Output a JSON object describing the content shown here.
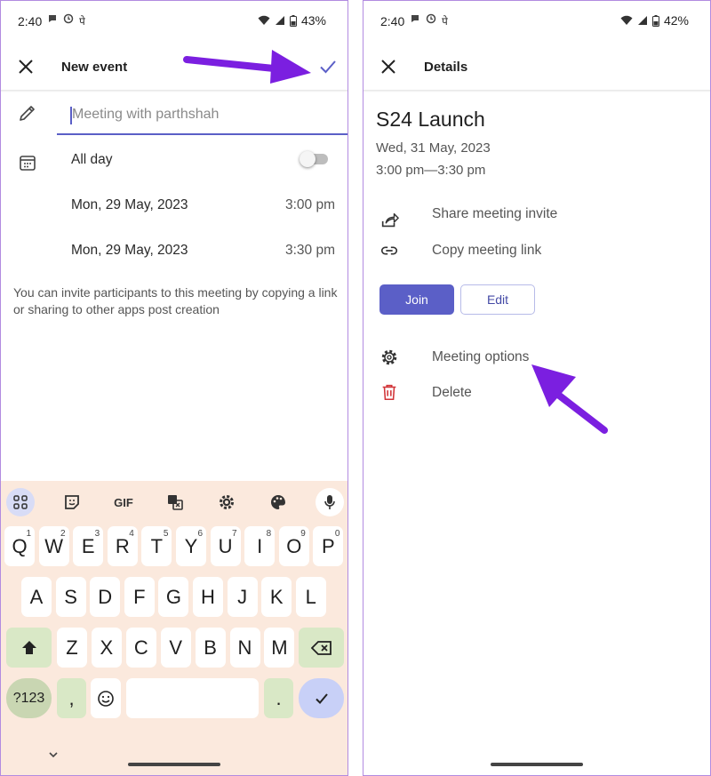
{
  "status_left": {
    "time": "2:40",
    "battery": "43%"
  },
  "status_right": {
    "time": "2:40",
    "battery": "42%"
  },
  "status_icons": {
    "hindi": "पे"
  },
  "new_event": {
    "title": "New event",
    "title_placeholder": "Meeting with parthshah",
    "all_day_label": "All day",
    "all_day_on": false,
    "start_date": "Mon, 29 May, 2023",
    "start_time": "3:00 pm",
    "end_date": "Mon, 29 May, 2023",
    "end_time": "3:30 pm",
    "invite_note": "You can invite participants to this meeting by copying a link or sharing to other apps post creation"
  },
  "keyboard": {
    "gif_label": "GIF",
    "row1": [
      {
        "k": "Q",
        "n": "1"
      },
      {
        "k": "W",
        "n": "2"
      },
      {
        "k": "E",
        "n": "3"
      },
      {
        "k": "R",
        "n": "4"
      },
      {
        "k": "T",
        "n": "5"
      },
      {
        "k": "Y",
        "n": "6"
      },
      {
        "k": "U",
        "n": "7"
      },
      {
        "k": "I",
        "n": "8"
      },
      {
        "k": "O",
        "n": "9"
      },
      {
        "k": "P",
        "n": "0"
      }
    ],
    "row2": [
      "A",
      "S",
      "D",
      "F",
      "G",
      "H",
      "J",
      "K",
      "L"
    ],
    "row3": [
      "Z",
      "X",
      "C",
      "V",
      "B",
      "N",
      "M"
    ],
    "symbols_label": "?123",
    "comma": ",",
    "period": "."
  },
  "details": {
    "title": "Details",
    "event_name": "S24 Launch",
    "date": "Wed, 31 May, 2023",
    "time": "3:00 pm—3:30 pm",
    "share": "Share meeting invite",
    "copy": "Copy meeting link",
    "join": "Join",
    "edit": "Edit",
    "options": "Meeting options",
    "delete": "Delete"
  },
  "colors": {
    "accent": "#5b5fc7",
    "annotation_arrow": "#7b1fe0",
    "delete_red": "#d13438",
    "keyboard_bg": "#fbe9dd"
  }
}
